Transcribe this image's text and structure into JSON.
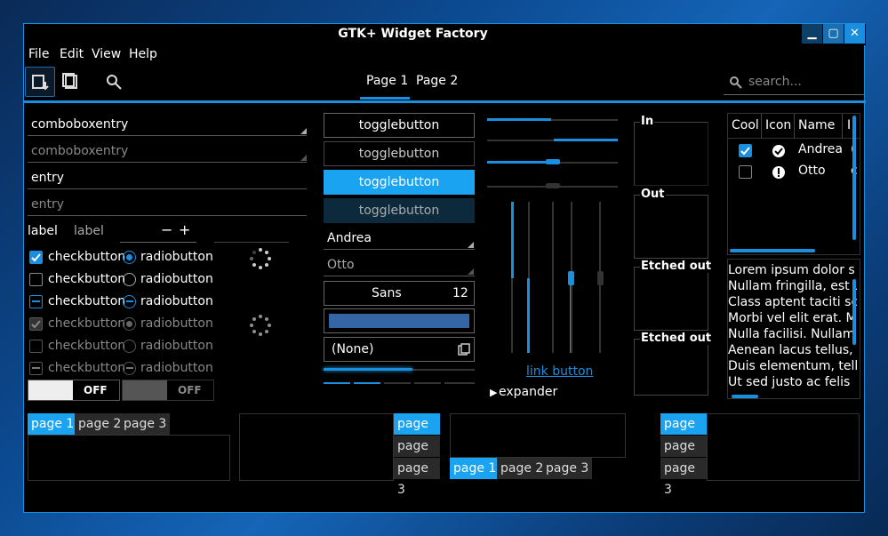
{
  "window": {
    "title": "GTK+ Widget Factory"
  },
  "menu": [
    "File",
    "Edit",
    "View",
    "Help"
  ],
  "search": {
    "placeholder": "search..."
  },
  "tabs": {
    "page1": "Page 1",
    "page2": "Page 2"
  },
  "left": {
    "combo1": "comboboxentry",
    "combo2": "comboboxentry",
    "entry1": "entry",
    "entry2": "entry",
    "label1": "label",
    "label2": "label",
    "check_label": "checkbutton",
    "radio_label": "radiobutton",
    "switch1": "OFF",
    "switch2": "OFF"
  },
  "middle": {
    "toggles": [
      "togglebutton",
      "togglebutton",
      "togglebutton",
      "togglebutton"
    ],
    "combo_andrea": "Andrea",
    "combo_otto": "Otto",
    "font_name": "Sans",
    "font_size": "12",
    "file_none": "(None)"
  },
  "sliders": {
    "link": "link button",
    "expander": "expander"
  },
  "frames": [
    "In",
    "Out",
    "Etched out",
    "Etched out"
  ],
  "tree": {
    "headers": [
      "Cool",
      "Icon",
      "Name"
    ],
    "rows": [
      {
        "name": "Andrea",
        "checked": true
      },
      {
        "name": "Otto",
        "checked": false
      }
    ]
  },
  "textview": [
    "Lorem ipsum dolor s",
    "Nullam fringilla, est u",
    "Class aptent taciti sc",
    "Morbi vel elit erat. M",
    "Nulla facilisi. Nullam",
    "Aenean lacus tellus,",
    "Duis elementum, tell",
    "Ut sed justo ac felis"
  ],
  "notebooks": {
    "a": [
      "page 1",
      "page 2",
      "page 3"
    ],
    "b": [
      "page 1",
      "page 2",
      "page 3"
    ],
    "c": [
      "page 1",
      "page 2",
      "page 3"
    ],
    "d": [
      "page 1",
      "page 2",
      "page 3"
    ]
  },
  "colors": {
    "accent": "#1aa3f0",
    "bg": "#000000"
  }
}
